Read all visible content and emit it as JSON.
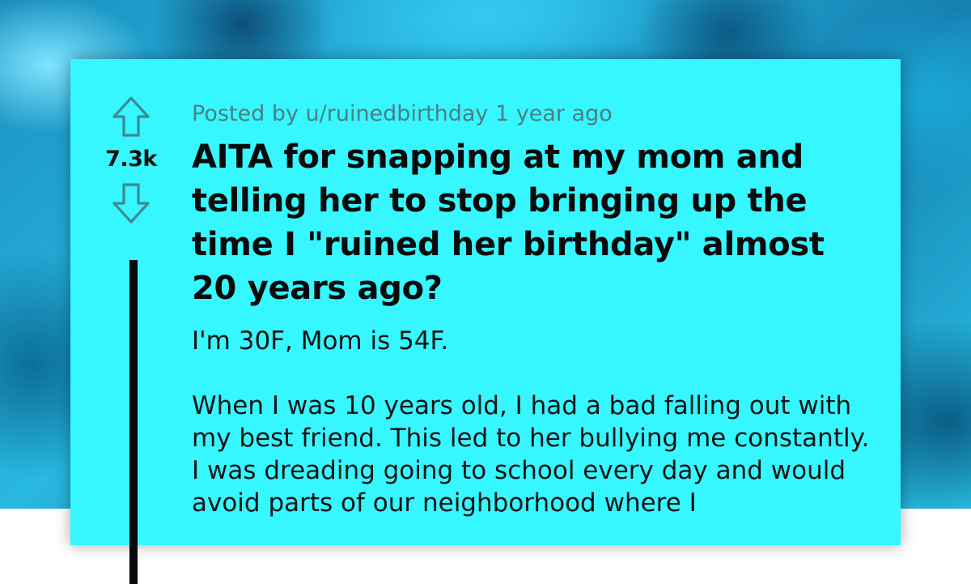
{
  "post": {
    "score": "7.3k",
    "meta": "Posted by u/ruinedbirthday 1 year ago",
    "title": "AITA for snapping at my mom and telling her to stop bringing up the time I \"ruined her birthday\" almost 20 years ago?",
    "paragraphs": [
      "I'm 30F, Mom is 54F.",
      "When I was 10 years old, I had a bad falling out with my best friend. This led to her bullying me constant­ly. I was dreading going to school every day and would avoid parts of our neighborhood where I"
    ]
  },
  "icons": {
    "upvote": "upvote-arrow-icon",
    "downvote": "downvote-arrow-icon"
  },
  "colors": {
    "card": "#36f6ff",
    "meta_text": "#4b7f84",
    "icon_stroke": "#3e8a90"
  }
}
